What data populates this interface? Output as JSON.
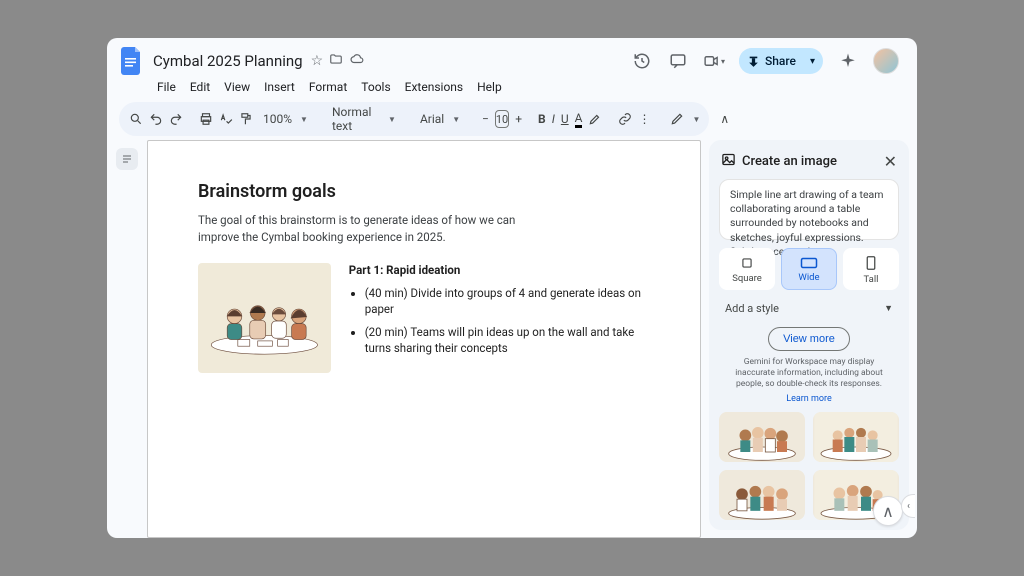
{
  "header": {
    "doc_title": "Cymbal 2025 Planning",
    "menus": [
      "File",
      "Edit",
      "View",
      "Insert",
      "Format",
      "Tools",
      "Extensions",
      "Help"
    ],
    "share_label": "Share"
  },
  "toolbar": {
    "zoom": "100%",
    "style": "Normal text",
    "font": "Arial",
    "font_size": "10"
  },
  "document": {
    "heading": "Brainstorm goals",
    "intro": "The goal of this brainstorm is to generate ideas of how we can improve the Cymbal booking experience in 2025.",
    "section_title": "Part 1: Rapid ideation",
    "bullets": [
      "(40 min) Divide into groups of 4 and generate ideas on paper",
      "(20 min) Teams will pin ideas up on the wall and take turns sharing their concepts"
    ]
  },
  "sidepanel": {
    "title": "Create an image",
    "prompt": "Simple line art drawing of a team collaborating around a table surrounded by notebooks and sketches, joyful expressions. Subtle accent colors.",
    "aspects": {
      "square": "Square",
      "wide": "Wide",
      "tall": "Tall"
    },
    "style_label": "Add a style",
    "view_more": "View more",
    "disclaimer": "Gemini for Workspace may display inaccurate information, including about people, so double-check its responses.",
    "learn_more": "Learn more"
  }
}
